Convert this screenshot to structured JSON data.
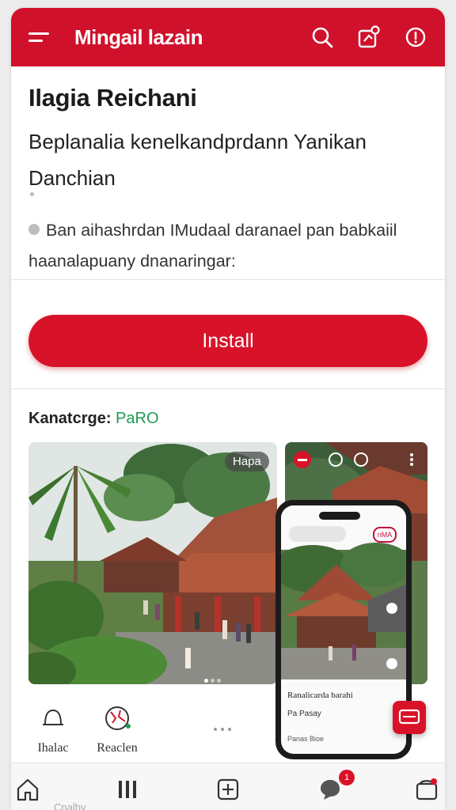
{
  "header": {
    "title": "Mingail lazain",
    "icons": [
      "menu-icon",
      "search-icon",
      "share-icon",
      "info-icon"
    ]
  },
  "app": {
    "name": "Ilagia Reichani",
    "subtitle": "Beplanalia kenelkandprdann Yanikan Danchian",
    "description": "Ban aihashrdan IMudaal daranael pan babkaiil haanalapuany dnanaringar:"
  },
  "install": {
    "label": "Install"
  },
  "category": {
    "label": "Kanatcrge:",
    "value": "PaRO"
  },
  "screenshots": {
    "badge": "Hapa",
    "phone_badge": "nMA",
    "phone_title": "Ranalicarda barahi",
    "phone_row": "Pa   Pasay",
    "phone_foot": "Panas            Bioe"
  },
  "actions": [
    {
      "label": "Ihalac",
      "icon": "bell-icon"
    },
    {
      "label": "Reaclen",
      "icon": "globe-icon"
    }
  ],
  "bottom_nav": {
    "items": [
      "home-icon",
      "library-icon",
      "add-icon",
      "chat-icon",
      "store-icon"
    ],
    "notification_count": "1",
    "faint_label": "Cnalby"
  },
  "colors": {
    "brand": "#d0112b",
    "accent_green": "#1e9b56"
  }
}
